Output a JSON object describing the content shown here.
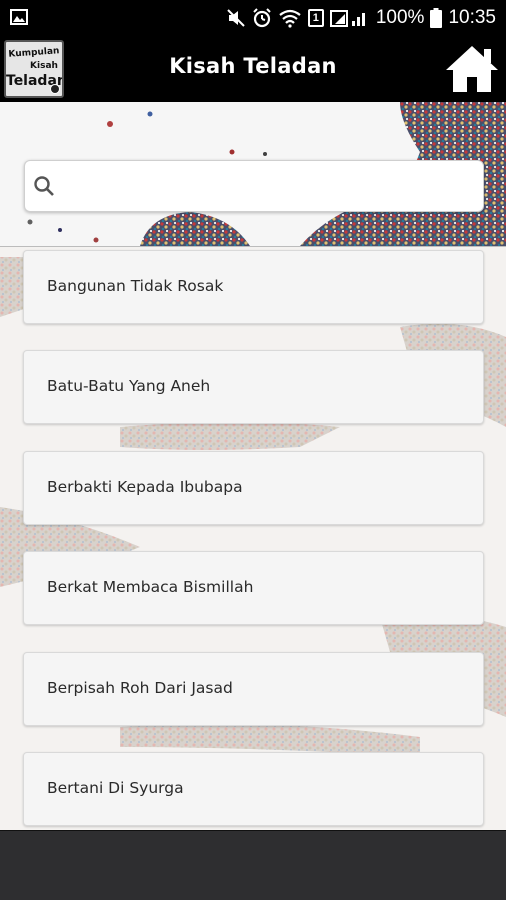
{
  "status_bar": {
    "battery_text": "100%",
    "time": "10:35",
    "sim_label": "1",
    "icons": [
      "image-notification-icon",
      "mute-icon",
      "alarm-icon",
      "wifi-icon",
      "sim-icon",
      "signal-icon",
      "battery-icon"
    ]
  },
  "app_bar": {
    "title": "Kisah Teladan",
    "logo_lines": [
      "Kumpulan",
      "Kisah",
      "Teladan"
    ],
    "home_icon": "home-icon"
  },
  "search": {
    "placeholder": "",
    "value": "",
    "icon": "search-icon"
  },
  "stories": [
    {
      "title": "Bangunan Tidak Rosak"
    },
    {
      "title": "Batu-Batu Yang Aneh"
    },
    {
      "title": "Berbakti Kepada Ibubapa"
    },
    {
      "title": "Berkat Membaca Bismillah"
    },
    {
      "title": "Berpisah Roh Dari Jasad"
    },
    {
      "title": "Bertani Di Syurga"
    }
  ],
  "colors": {
    "app_bar": "#000000",
    "card_bg": "#f5f5f5",
    "bottom_bar": "#2e2e30"
  }
}
